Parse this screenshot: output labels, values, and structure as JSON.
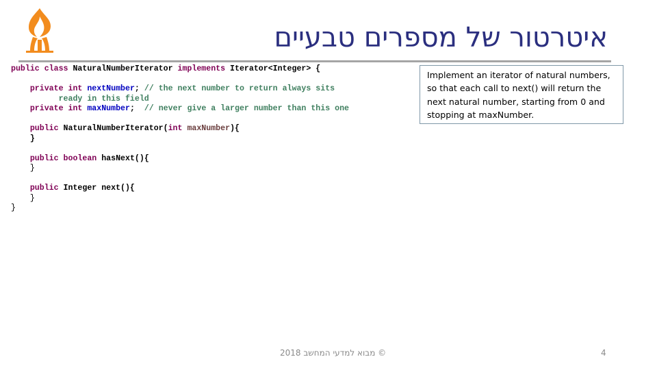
{
  "slide": {
    "title": "איטרטור של מספרים טבעיים",
    "logo_icon": "university-flame-logo",
    "accent_color": "#f28c1e",
    "title_color": "#2b2f7f",
    "rule_color": "#a5a5a5"
  },
  "code": {
    "lines": [
      [
        {
          "t": "public class ",
          "c": "kw"
        },
        {
          "t": "NaturalNumberIterator ",
          "c": "plain"
        },
        {
          "t": "implements ",
          "c": "kw"
        },
        {
          "t": "Iterator<Integer> {",
          "c": "plain"
        }
      ],
      [],
      [
        {
          "t": "    private int ",
          "c": "kw"
        },
        {
          "t": "nextNumber",
          "c": "fld"
        },
        {
          "t": "; ",
          "c": "plain"
        },
        {
          "t": "// the next number to return always sits",
          "c": "cm"
        }
      ],
      [
        {
          "t": "          ready in this field",
          "c": "cm"
        }
      ],
      [
        {
          "t": "    private int ",
          "c": "kw"
        },
        {
          "t": "maxNumber",
          "c": "fld"
        },
        {
          "t": ";  ",
          "c": "plain"
        },
        {
          "t": "// never give a larger number than this one",
          "c": "cm"
        }
      ],
      [],
      [
        {
          "t": "    public ",
          "c": "kw"
        },
        {
          "t": "NaturalNumberIterator(",
          "c": "plain"
        },
        {
          "t": "int ",
          "c": "kw"
        },
        {
          "t": "maxNumber",
          "c": "par"
        },
        {
          "t": "){",
          "c": "plain"
        }
      ],
      [
        {
          "t": "    }",
          "c": "plain"
        }
      ],
      [],
      [
        {
          "t": "    public boolean ",
          "c": "kw"
        },
        {
          "t": "hasNext(){",
          "c": "plain"
        }
      ],
      [
        {
          "t": "    }",
          "c": "brace-light"
        }
      ],
      [],
      [
        {
          "t": "    public ",
          "c": "kw"
        },
        {
          "t": "Integer next(){",
          "c": "plain"
        }
      ],
      [
        {
          "t": "    }",
          "c": "brace-light"
        }
      ],
      [
        {
          "t": "}",
          "c": "brace-light"
        }
      ]
    ]
  },
  "note": {
    "text": "Implement an iterator of natural numbers, so that each call to next() will return the next natural number, starting from 0 and stopping at maxNumber."
  },
  "footer": {
    "text": "מבוא למדעי המחשב 2018 ©",
    "page_number": "4"
  }
}
